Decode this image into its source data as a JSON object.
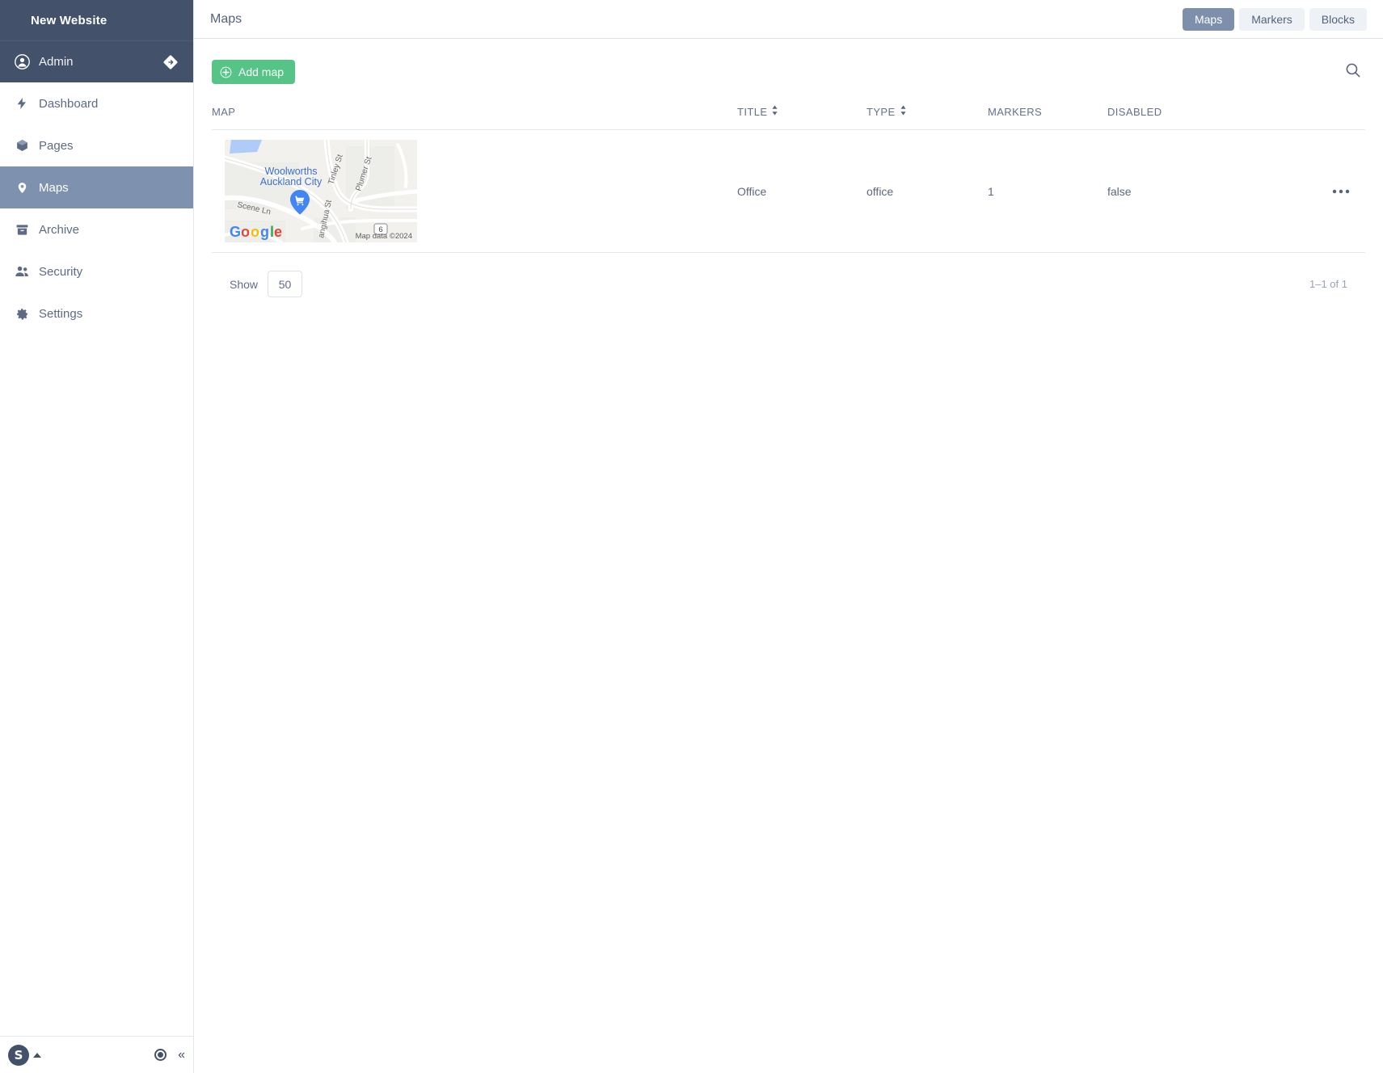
{
  "sidebar": {
    "brand": "New Website",
    "user": {
      "name": "Admin",
      "avatar_icon": "user-circle-icon",
      "exit_icon": "exit-diamond-icon"
    },
    "items": [
      {
        "label": "Dashboard",
        "icon": "lightning-bolt-icon",
        "active": false
      },
      {
        "label": "Pages",
        "icon": "cube-icon",
        "active": false
      },
      {
        "label": "Maps",
        "icon": "map-pin-icon",
        "active": true
      },
      {
        "label": "Archive",
        "icon": "archive-box-icon",
        "active": false
      },
      {
        "label": "Security",
        "icon": "people-icon",
        "active": false
      },
      {
        "label": "Settings",
        "icon": "gear-icon",
        "active": false
      }
    ],
    "footer": {
      "logo_glyph": "S",
      "caret_icon": "caret-up-icon",
      "target_icon": "target-radio-icon",
      "collapse_icon": "chevron-double-left-icon",
      "collapse_glyph": "«"
    },
    "colors": {
      "header_bg": "#43516b",
      "active_bg": "#7e91ae",
      "text": "#5d6b85"
    }
  },
  "header": {
    "title": "Maps",
    "tabs": [
      {
        "label": "Maps",
        "active": true
      },
      {
        "label": "Markers",
        "active": false
      },
      {
        "label": "Blocks",
        "active": false
      }
    ]
  },
  "toolbar": {
    "add_label": "Add map",
    "add_icon": "plus-circle-icon",
    "add_color": "#56c486",
    "search_icon": "search-icon"
  },
  "table": {
    "columns": [
      {
        "key": "map",
        "label": "MAP",
        "sortable": false
      },
      {
        "key": "title",
        "label": "TITLE",
        "sortable": true
      },
      {
        "key": "type",
        "label": "TYPE",
        "sortable": true
      },
      {
        "key": "markers",
        "label": "MARKERS",
        "sortable": false
      },
      {
        "key": "disabled",
        "label": "DISABLED",
        "sortable": false
      }
    ],
    "rows": [
      {
        "map_thumbnail": {
          "provider_logo": "Google",
          "place_label_line1": "Woolworths",
          "place_label_line2": "Auckland City",
          "streets": [
            "Scene Ln",
            "Tinley St",
            "Plumer St",
            "angihua St"
          ],
          "route_shield": "6",
          "attribution": "Map data ©2024",
          "marker_icon": "shopping-cart-pin-icon"
        },
        "title": "Office",
        "type": "office",
        "markers": "1",
        "disabled": "false",
        "actions_icon": "ellipsis-icon"
      }
    ]
  },
  "footer": {
    "show_label": "Show",
    "show_value": "50",
    "pagination": "1–1 of 1"
  }
}
